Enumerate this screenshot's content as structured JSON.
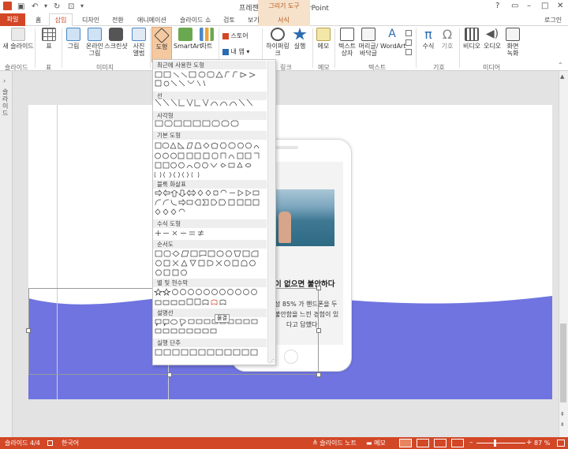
{
  "window": {
    "title": "프레젠테이션2 - PowerPoint",
    "context_tab_group": "그리기 도구",
    "account": "로그인",
    "buttons": [
      "?",
      "▭",
      "–",
      "□",
      "✕"
    ]
  },
  "tabs": [
    "파일",
    "홈",
    "삽입",
    "디자인",
    "전환",
    "애니메이션",
    "슬라이드 쇼",
    "검토",
    "보기",
    "서식"
  ],
  "active_tab": "삽입",
  "ribbon": {
    "groups": [
      {
        "label": "슬라이드",
        "buttons": [
          "새 슬라이드"
        ]
      },
      {
        "label": "표",
        "buttons": [
          "표"
        ]
      },
      {
        "label": "이미지",
        "buttons": [
          "그림",
          "온라인 그림",
          "스크린샷",
          "사진 앨범"
        ]
      },
      {
        "label": "",
        "buttons": [
          "도형",
          "SmartArt",
          "차트"
        ]
      },
      {
        "label": "",
        "buttons": [
          "스토어",
          "내 앱"
        ]
      },
      {
        "label": "링크",
        "buttons": [
          "하이퍼링크",
          "실행"
        ]
      },
      {
        "label": "메모",
        "buttons": [
          "메모"
        ]
      },
      {
        "label": "텍스트",
        "buttons": [
          "텍스트 상자",
          "머리글/바닥글",
          "WordArt"
        ]
      },
      {
        "label": "기호",
        "buttons": [
          "수식",
          "기호"
        ]
      },
      {
        "label": "미디어",
        "buttons": [
          "비디오",
          "오디오",
          "화면 녹화"
        ]
      }
    ]
  },
  "shapes_gallery": {
    "sections": [
      "최근에 사용한 도형",
      "선",
      "사각형",
      "기본 도형",
      "블록 화살표",
      "수식 도형",
      "순서도",
      "별 및 현수막",
      "설명선",
      "실행 단추"
    ],
    "tooltip": "물결"
  },
  "thumbnail_pane": {
    "label": "슬라이드"
  },
  "slide_content": {
    "heading": "이 없으면 불안하다",
    "body_lines": [
      "성 85% 가 핸드폰을 두",
      "불안함을 느낀 경험이 있",
      "다고 답했다"
    ],
    "wave_color": "#6f74e0"
  },
  "statusbar": {
    "slide_indicator": "슬라이드 4/4",
    "language": "한국어",
    "notes": "슬라이드 노트",
    "comments": "메모",
    "zoom": "87 %"
  },
  "colors": {
    "accent": "#d24726",
    "context": "#f6e2cb",
    "selected_button": "#f4c9a0"
  }
}
